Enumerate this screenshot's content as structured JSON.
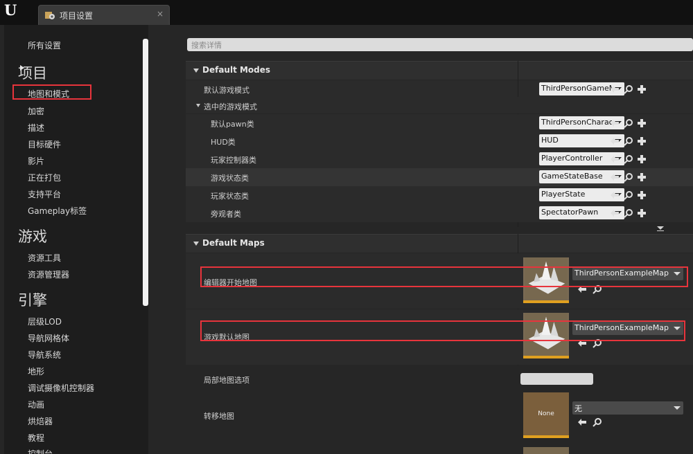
{
  "app": {
    "logo": "U"
  },
  "tab": {
    "title": "项目设置",
    "close": "×",
    "icon": "settings-icon"
  },
  "sidebar": {
    "all_settings": "所有设置",
    "sections": [
      {
        "title": "项目",
        "items": [
          "地图和模式",
          "加密",
          "描述",
          "目标硬件",
          "影片",
          "正在打包",
          "支持平台",
          "Gameplay标签"
        ]
      },
      {
        "title": "游戏",
        "items": [
          "资源工具",
          "资源管理器"
        ]
      },
      {
        "title": "引擎",
        "items": [
          "层级LOD",
          "导航网格体",
          "导航系统",
          "地形",
          "调试摄像机控制器",
          "动画",
          "烘焙器",
          "教程",
          "控制台"
        ]
      }
    ]
  },
  "search": {
    "placeholder": "搜索详情"
  },
  "default_modes": {
    "title": "Default Modes",
    "default_game_mode": {
      "label": "默认游戏模式",
      "value": "ThirdPersonGameMo"
    },
    "selected_game_mode": {
      "label": "选中的游戏模式",
      "rows": [
        {
          "label": "默认pawn类",
          "value": "ThirdPersonCharacte"
        },
        {
          "label": "HUD类",
          "value": "HUD"
        },
        {
          "label": "玩家控制器类",
          "value": "PlayerController"
        },
        {
          "label": "游戏状态类",
          "value": "GameStateBase"
        },
        {
          "label": "玩家状态类",
          "value": "PlayerState"
        },
        {
          "label": "旁观者类",
          "value": "SpectatorPawn"
        }
      ]
    }
  },
  "default_maps": {
    "title": "Default Maps",
    "editor_startup_map": {
      "label": "编辑器开始地图",
      "value": "ThirdPersonExampleMap"
    },
    "game_default_map": {
      "label": "游戏默认地图",
      "value": "ThirdPersonExampleMap"
    },
    "local_map_options": {
      "label": "局部地图选项",
      "value": ""
    },
    "transition_map": {
      "label": "转移地图",
      "value": "无",
      "thumb_text": "None"
    }
  }
}
